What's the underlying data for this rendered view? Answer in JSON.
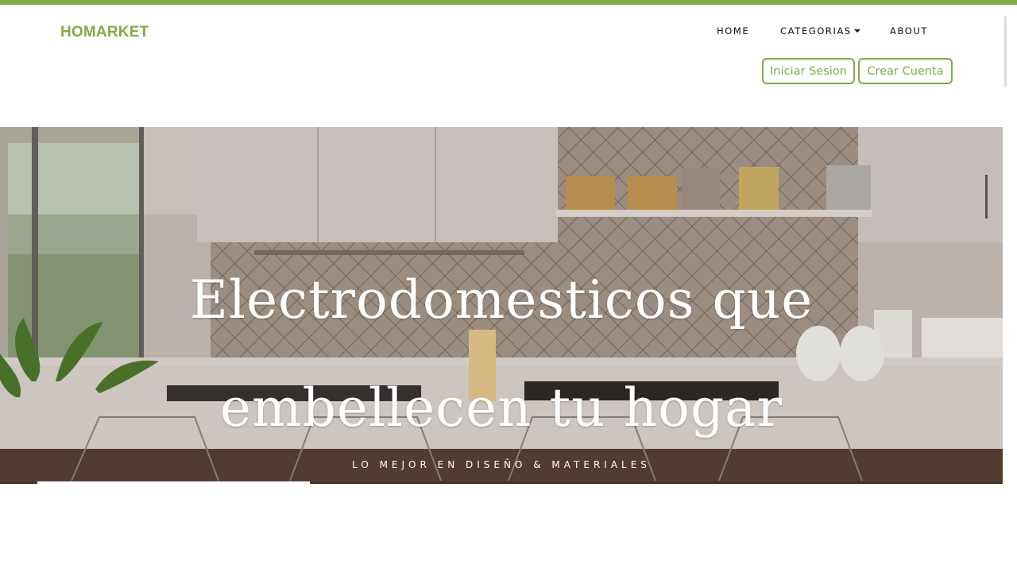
{
  "brand": {
    "name": "HOMARKET",
    "color": "#7fad46"
  },
  "nav": {
    "items": [
      {
        "label": "HOME"
      },
      {
        "label": "CATEGORIAS",
        "icon": "caret-down-icon"
      },
      {
        "label": "ABOUT"
      }
    ]
  },
  "auth": {
    "login_label": "Iniciar Sesion",
    "signup_label": "Crear Cuenta"
  },
  "hero": {
    "title": "Electrodomesticos que embellecen tu hogar",
    "subtitle": "LO MEJOR EN DISEÑO & MATERIALES",
    "image": "kitchen-background-image"
  },
  "colors": {
    "accent": "#7fad46",
    "text": "#111111"
  }
}
